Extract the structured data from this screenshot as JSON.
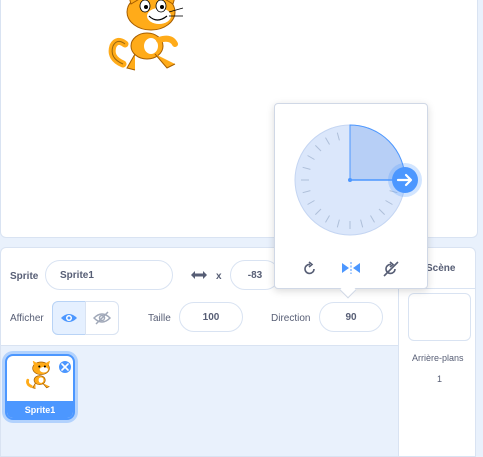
{
  "sprite": {
    "label": "Sprite",
    "name": "Sprite1",
    "x_label": "x",
    "x_value": "-83",
    "show_label": "Afficher",
    "size_label": "Taille",
    "size_value": "100",
    "direction_label": "Direction",
    "direction_value": "90"
  },
  "sprite_list": {
    "items": [
      {
        "name": "Sprite1"
      }
    ]
  },
  "stage_panel": {
    "title": "Scène",
    "backdrops_label": "Arrière-plans",
    "backdrops_count": "1"
  },
  "direction_popover": {
    "direction_degrees": 90,
    "rotation_styles": [
      "all-around",
      "left-right",
      "dont-rotate"
    ],
    "selected_style": "left-right"
  },
  "colors": {
    "accent": "#4c97ff",
    "cat_orange": "#ffab19"
  },
  "icons": {
    "x_arrows": "horizontal-arrows-icon",
    "show": "eye-icon",
    "hide": "eye-slash-icon",
    "rotate_all": "rotate-icon",
    "left_right": "left-right-icon",
    "no_rotate": "no-rotate-icon",
    "delete": "close-icon"
  }
}
